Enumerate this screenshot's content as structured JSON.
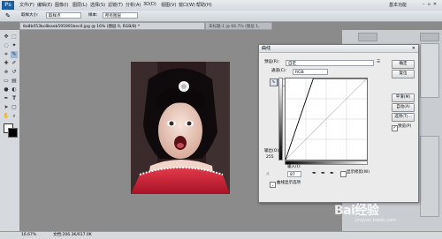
{
  "app": {
    "logo": "Ps"
  },
  "menu": [
    "文件(F)",
    "编辑(E)",
    "图像(I)",
    "图层(L)",
    "选择(S)",
    "滤镜(T)",
    "分析(A)",
    "3D(D)",
    "视图(V)",
    "窗口(W)",
    "帮助(H)"
  ],
  "workspace": "基本功能",
  "options": {
    "feather_label": "取样大小:",
    "feather_value": "取样点",
    "sample_label": "样本:",
    "sample_value": "所有图层"
  },
  "document": {
    "tab_title": "8a8b053bc8baeb595991bec0.jpg @ 16% (图层 0, RGB/8) *",
    "tab2_title": "未标题-1 @ 66.7% (图层 1, RGB/8)"
  },
  "status": {
    "zoom": "16.67%",
    "doc_size": "文档:206.3K/617.0K"
  },
  "curves": {
    "title": "曲线",
    "preset_label": "预设(R):",
    "preset_value": "自定",
    "channel_label": "通道(C):",
    "channel_value": "RGB",
    "output_label": "输出(O):",
    "output_value": "255",
    "input_label": "输入(I):",
    "input_value": "87",
    "show_clip_label": "显示修剪(W)",
    "options_label": "曲线显示选项",
    "buttons": [
      "确定",
      "复位",
      "平滑(M)",
      "自动(A)",
      "选项(T)..."
    ],
    "preview_label": "预览(P)",
    "curve_points": [
      [
        0,
        0
      ],
      [
        87,
        255
      ],
      [
        255,
        255
      ]
    ]
  },
  "watermark": {
    "text": "Bai经验",
    "sub": "jingyan.baidu.com"
  },
  "colors": {
    "accent": "#1d5e9c",
    "dialog_bg": "#ebebeb"
  }
}
